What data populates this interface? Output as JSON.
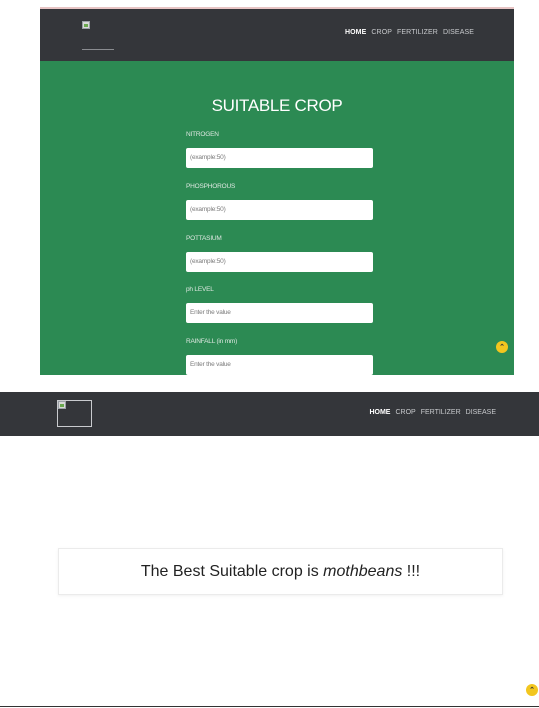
{
  "colors": {
    "navbar": "#34363a",
    "form_background": "#2c8a53",
    "scroll_button": "#f2c61f"
  },
  "top_screenshot": {
    "nav": {
      "links": [
        "HOME",
        "CROP",
        "FERTILIZER",
        "DISEASE"
      ],
      "active": "HOME"
    },
    "form": {
      "title": "SUITABLE CROP",
      "fields": [
        {
          "label": "NITROGEN",
          "value": "(example:50)"
        },
        {
          "label": "PHOSPHOROUS",
          "value": "(example:50)"
        },
        {
          "label": "POTTASIUM",
          "value": "(example:50)"
        },
        {
          "label": "ph LEVEL",
          "value": "Enter the value"
        },
        {
          "label": "RAINFALL (in mm)",
          "value": "Enter the value"
        }
      ]
    },
    "scroll_top_icon": "chevron-up-icon"
  },
  "bottom_screenshot": {
    "nav": {
      "links": [
        "HOME",
        "CROP",
        "FERTILIZER",
        "DISEASE"
      ],
      "active": "HOME"
    },
    "result": {
      "prefix": "The Best Suitable crop is ",
      "crop": "mothbeans",
      "suffix": " !!!"
    },
    "scroll_top_icon": "chevron-up-icon"
  }
}
